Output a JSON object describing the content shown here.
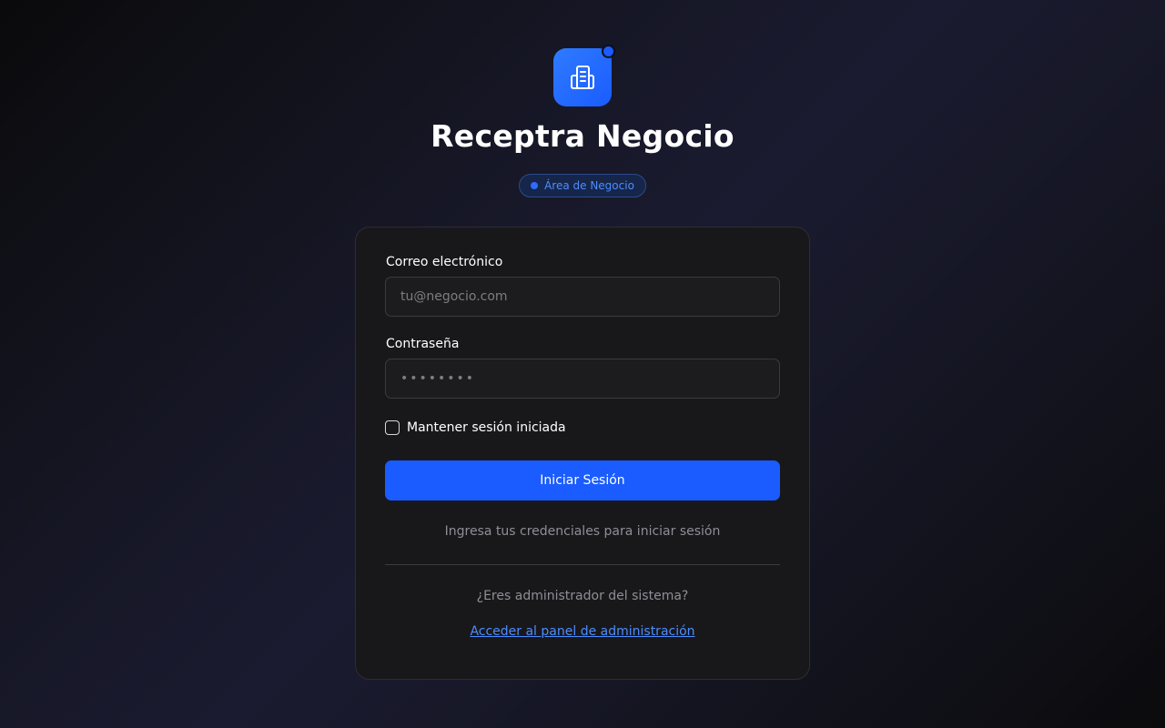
{
  "brand": {
    "logo_icon": "building-icon",
    "title": "Receptra Negocio",
    "badge": "Área de Negocio",
    "accent_color": "#1a5cff"
  },
  "form": {
    "email_label": "Correo electrónico",
    "email_placeholder": "tu@negocio.com",
    "email_value": "",
    "password_label": "Contraseña",
    "password_placeholder": "••••••••",
    "password_value": "",
    "remember_label": "Mantener sesión iniciada",
    "remember_checked": false,
    "submit_label": "Iniciar Sesión",
    "hint": "Ingresa tus credenciales para iniciar sesión"
  },
  "admin": {
    "question": "¿Eres administrador del sistema?",
    "link_label": "Acceder al panel de administración"
  }
}
